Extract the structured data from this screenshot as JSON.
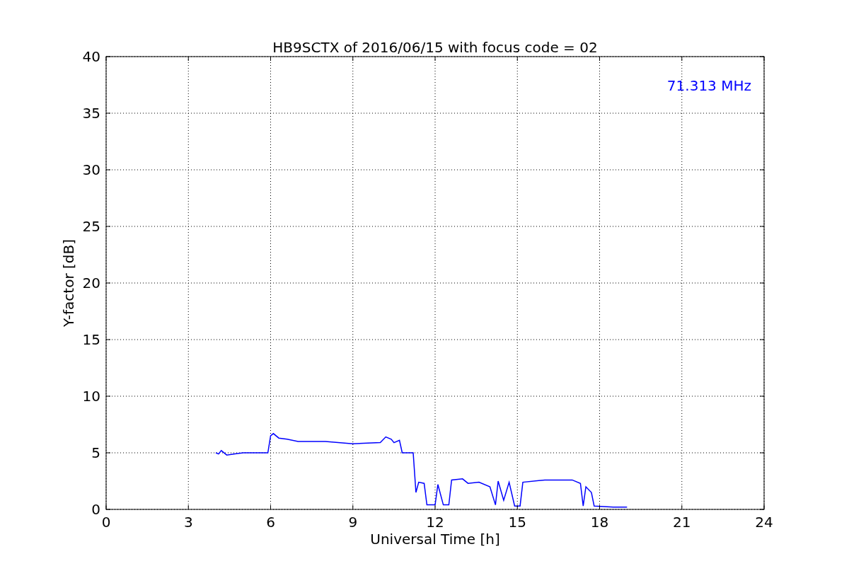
{
  "figure": {
    "chart_data": {
      "type": "line",
      "title": "HB9SCTX of 2016/06/15 with focus code = 02",
      "xlabel": "Universal Time [h]",
      "ylabel": "Y-factor [dB]",
      "x": [
        4.0,
        4.1,
        4.2,
        4.4,
        4.7,
        5.0,
        5.5,
        5.9,
        6.0,
        6.1,
        6.3,
        6.6,
        7.0,
        8.0,
        9.0,
        10.0,
        10.2,
        10.4,
        10.5,
        10.7,
        10.8,
        11.2,
        11.3,
        11.4,
        11.6,
        11.7,
        12.0,
        12.1,
        12.3,
        12.5,
        12.6,
        13.0,
        13.2,
        13.6,
        14.0,
        14.2,
        14.3,
        14.5,
        14.7,
        14.9,
        15.1,
        15.2,
        16.0,
        17.0,
        17.3,
        17.4,
        17.5,
        17.7,
        17.8,
        18.5,
        19.0
      ],
      "series": [
        {
          "color": "#0000ff",
          "values": [
            5.0,
            4.9,
            5.2,
            4.8,
            4.9,
            5.0,
            5.0,
            5.0,
            6.5,
            6.7,
            6.3,
            6.2,
            6.0,
            6.0,
            5.8,
            5.9,
            6.4,
            6.2,
            5.9,
            6.1,
            5.0,
            5.0,
            1.5,
            2.4,
            2.3,
            0.4,
            0.4,
            2.2,
            0.4,
            0.4,
            2.6,
            2.7,
            2.3,
            2.4,
            2.0,
            0.4,
            2.5,
            0.8,
            2.4,
            0.3,
            0.3,
            2.4,
            2.6,
            2.6,
            2.3,
            0.3,
            2.0,
            1.5,
            0.3,
            0.2,
            0.2
          ]
        }
      ],
      "xlim": [
        0,
        24
      ],
      "ylim": [
        0,
        40
      ],
      "xticks": [
        0,
        3,
        6,
        9,
        12,
        15,
        18,
        21,
        24
      ],
      "yticks": [
        0,
        5,
        10,
        15,
        20,
        25,
        30,
        35,
        40
      ],
      "grid": true,
      "annotations": [
        "71.313 MHz"
      ]
    }
  }
}
